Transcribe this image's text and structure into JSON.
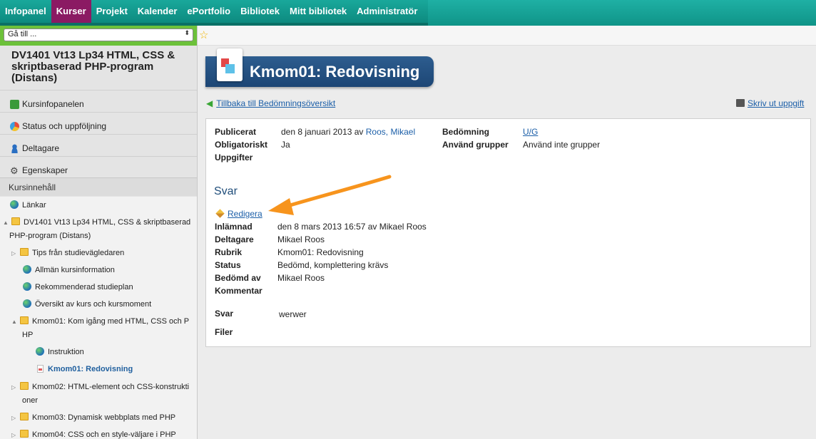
{
  "nav": {
    "tabs": [
      "Infopanel",
      "Kurser",
      "Projekt",
      "Kalender",
      "ePortfolio",
      "Bibliotek",
      "Mitt bibliotek",
      "Administratör"
    ],
    "active_index": 1
  },
  "sidebar": {
    "goto_placeholder": "Gå till ...",
    "course_title": "DV1401 Vt13 Lp34 HTML, CSS & skriptbaserad PHP-program (Distans)",
    "items": [
      {
        "label": "Kursinfopanelen",
        "icon": "info-panel-icon"
      },
      {
        "label": "Status och uppföljning",
        "icon": "status-icon"
      },
      {
        "label": "Deltagare",
        "icon": "person-icon"
      },
      {
        "label": "Egenskaper",
        "icon": "gear-icon"
      }
    ],
    "content_heading": "Kursinnehåll",
    "tree": [
      {
        "label": "Länkar",
        "type": "globe"
      },
      {
        "label1": "DV1401 Vt13 Lp34 HTML, CSS & skriptbaserad",
        "label2": "PHP-program (Distans)",
        "type": "folder"
      },
      {
        "label": "Tips från studievägledaren",
        "type": "folder"
      },
      {
        "label": "Allmän kursinformation",
        "type": "globe"
      },
      {
        "label": "Rekommenderad studieplan",
        "type": "globe"
      },
      {
        "label": "Översikt av kurs och kursmoment",
        "type": "globe"
      },
      {
        "label1": "Kmom01: Kom igång med HTML, CSS och P",
        "label2": "HP",
        "type": "folder"
      },
      {
        "label": "Instruktion",
        "type": "globe"
      },
      {
        "label": "Kmom01: Redovisning",
        "type": "doc"
      },
      {
        "label1": "Kmom02: HTML-element och CSS-konstrukti",
        "label2": "oner",
        "type": "folder"
      },
      {
        "label": "Kmom03: Dynamisk webbplats med PHP",
        "type": "folder"
      },
      {
        "label": "Kmom04: CSS och en style-väljare i PHP",
        "type": "folder"
      }
    ]
  },
  "page": {
    "title": "Kmom01: Redovisning",
    "back_link": "Tillbaka till Bedömningsöversikt",
    "print_link": "Skriv ut uppgift"
  },
  "details": {
    "published_label": "Publicerat",
    "published_value": "den 8 januari 2013 av ",
    "published_author": "Roos, Mikael",
    "mandatory_label": "Obligatoriskt",
    "mandatory_value": "Ja",
    "tasks_label": "Uppgifter",
    "grading_label": "Bedömning",
    "grading_value": "U/G",
    "groups_label": "Använd grupper",
    "groups_value": "Använd inte grupper"
  },
  "answer": {
    "heading": "Svar",
    "edit_link": "Redigera",
    "submitted_label": "Inlämnad",
    "submitted_value": "den 8 mars 2013 16:57 av Mikael Roos",
    "participant_label": "Deltagare",
    "participant_value": "Mikael Roos",
    "subject_label": "Rubrik",
    "subject_value": "Kmom01: Redovisning",
    "status_label": "Status",
    "status_value": "Bedömd, komplettering krävs",
    "graded_by_label": "Bedömd av",
    "graded_by_value": "Mikael Roos",
    "comment_label": "Kommentar",
    "answer_label": "Svar",
    "answer_value": "werwer",
    "files_label": "Filer"
  },
  "colors": {
    "nav_teal": "#16a194",
    "nav_active": "#8b1a63",
    "banner_blue": "#244f80",
    "link_blue": "#1c5fa8",
    "annotation_orange": "#f7941d"
  }
}
